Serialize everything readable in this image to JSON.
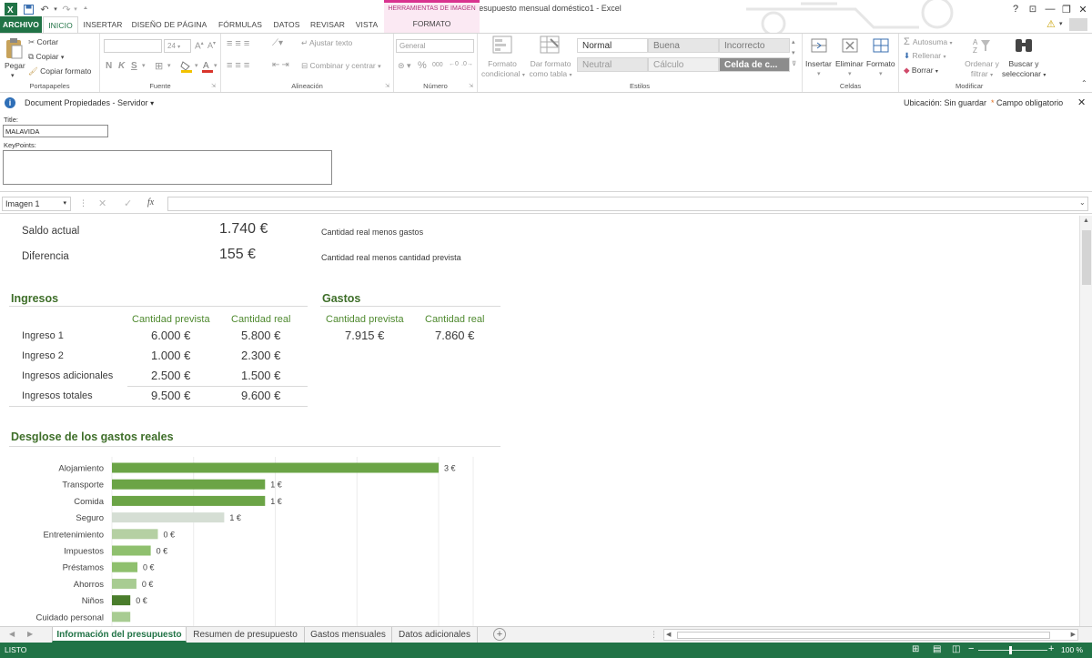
{
  "window": {
    "title": "Presupuesto mensual doméstico1 - Excel",
    "help": "?",
    "minimize": "—",
    "restore": "❐",
    "close": "✕"
  },
  "tabs": [
    {
      "label": "ARCHIVO"
    },
    {
      "label": "INICIO"
    },
    {
      "label": "INSERTAR"
    },
    {
      "label": "DISEÑO DE PÁGINA"
    },
    {
      "label": "FÓRMULAS"
    },
    {
      "label": "DATOS"
    },
    {
      "label": "REVISAR"
    },
    {
      "label": "VISTA"
    }
  ],
  "tools_header": {
    "label": "HERRAMIENTAS DE IMAGEN",
    "tab": "FORMATO"
  },
  "ribbon": {
    "clipboard": {
      "paste": "Pegar",
      "cut": "Cortar",
      "copy": "Copiar",
      "copy_format": "Copiar formato",
      "label": "Portapapeles"
    },
    "font": {
      "size": "24",
      "bold": "N",
      "italic": "K",
      "underline": "S",
      "label": "Fuente"
    },
    "alignment": {
      "wrap": "Ajustar texto",
      "merge": "Combinar y centrar",
      "label": "Alineación"
    },
    "number": {
      "format": "General",
      "label": "Número"
    },
    "styles": {
      "conditional": [
        "Formato",
        "condicional"
      ],
      "as_table": [
        "Dar formato",
        "como tabla"
      ],
      "cells": [
        {
          "label": "Normal",
          "bg": "#ffffff",
          "color": "#333333"
        },
        {
          "label": "Buena",
          "bg": "#e6e6e6",
          "color": "#777777"
        },
        {
          "label": "Incorrecto",
          "bg": "#e6e6e6",
          "color": "#777777"
        },
        {
          "label": "Neutral",
          "bg": "#e6e6e6",
          "color": "#999999"
        },
        {
          "label": "Cálculo",
          "bg": "#efefef",
          "color": "#999999"
        },
        {
          "label": "Celda de c...",
          "bg": "#8c8c8c",
          "color": "#ffffff"
        }
      ],
      "label": "Estilos"
    },
    "cells": {
      "insert": "Insertar",
      "delete": "Eliminar",
      "format": "Formato",
      "label": "Celdas"
    },
    "editing": {
      "autosum": "Autosuma",
      "fill": "Rellenar",
      "clear": "Borrar",
      "sort": [
        "Ordenar y",
        "filtrar"
      ],
      "find": [
        "Buscar y",
        "seleccionar"
      ],
      "label": "Modificar"
    }
  },
  "doc_props": {
    "header": "Document Propiedades - Servidor",
    "location": "Ubicación: Sin guardar",
    "required": "Campo obligatorio",
    "title_label": "Title:",
    "title_value": "MALAVIDA",
    "keypoints_label": "KeyPoints:"
  },
  "formula_bar": {
    "name_box": "Imagen 1",
    "fx": "fx"
  },
  "summary": [
    {
      "label": "Saldo actual",
      "value": "1.740 €",
      "note": "Cantidad real menos gastos"
    },
    {
      "label": "Diferencia",
      "value": "155 €",
      "note": "Cantidad real menos cantidad prevista"
    }
  ],
  "ingresos": {
    "title": "Ingresos",
    "col_planned": "Cantidad prevista",
    "col_actual": "Cantidad real",
    "rows": [
      {
        "label": "Ingreso 1",
        "planned": "6.000 €",
        "actual": "5.800 €"
      },
      {
        "label": "Ingreso 2",
        "planned": "1.000 €",
        "actual": "2.300 €"
      },
      {
        "label": "Ingresos adicionales",
        "planned": "2.500 €",
        "actual": "1.500 €"
      },
      {
        "label": "Ingresos totales",
        "planned": "9.500 €",
        "actual": "9.600 €"
      }
    ]
  },
  "gastos": {
    "title": "Gastos",
    "col_planned": "Cantidad prevista",
    "col_actual": "Cantidad real",
    "planned": "7.915 €",
    "actual": "7.860 €"
  },
  "breakdown_title": "Desglose de los gastos reales",
  "chart_data": {
    "type": "bar",
    "orientation": "horizontal",
    "categories": [
      "Alojamiento",
      "Transporte",
      "Comida",
      "Seguro",
      "Entretenimiento",
      "Impuestos",
      "Préstamos",
      "Ahorros",
      "Niños",
      "Cuidado personal"
    ],
    "values": [
      3200,
      1500,
      1500,
      1100,
      450,
      380,
      250,
      240,
      180,
      180
    ],
    "labels": [
      "3 €",
      "1 €",
      "1 €",
      "1 €",
      "0 €",
      "0 €",
      "0 €",
      "0 €",
      "0 €",
      ""
    ],
    "colors": [
      "#6ba446",
      "#6ba446",
      "#6ba446",
      "#d5ded4",
      "#b5d0a3",
      "#8fc06e",
      "#8fc06e",
      "#a8cc92",
      "#4a7d2c",
      "#a8cc92"
    ],
    "xlim": [
      0,
      3200
    ],
    "grid": true
  },
  "sheet_tabs": [
    {
      "label": "Información del presupuesto"
    },
    {
      "label": "Resumen de presupuesto"
    },
    {
      "label": "Gastos mensuales"
    },
    {
      "label": "Datos adicionales"
    }
  ],
  "status": {
    "ready": "LISTO",
    "zoom": "100 %"
  }
}
